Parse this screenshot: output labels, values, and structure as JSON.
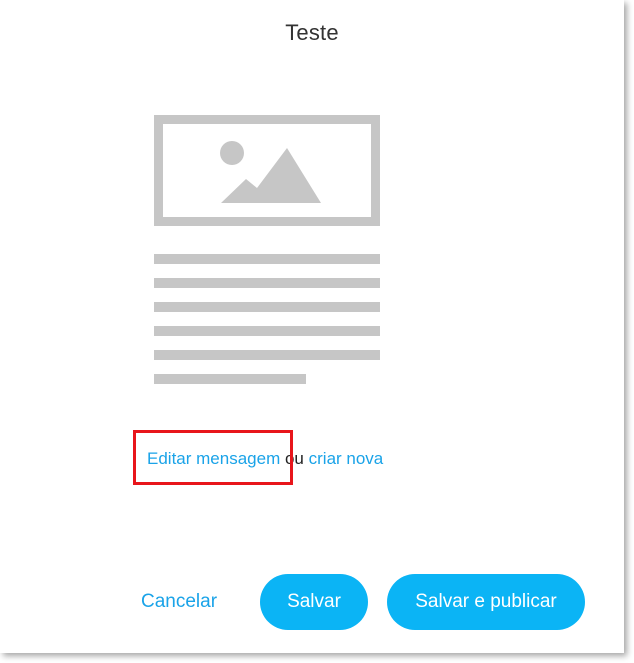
{
  "dialog": {
    "title": "Teste"
  },
  "preview": {
    "icon": "message-template-placeholder-icon",
    "color": "#c6c6c6"
  },
  "actions_line": {
    "edit_link": "Editar mensagem",
    "separator": "ou",
    "new_link": "criar nova"
  },
  "footer": {
    "cancel_label": "Cancelar",
    "save_label": "Salvar",
    "save_publish_label": "Salvar e publicar"
  },
  "colors": {
    "accent": "#0bb4f5",
    "link": "#1aa3e8",
    "highlight": "#e8151b"
  }
}
